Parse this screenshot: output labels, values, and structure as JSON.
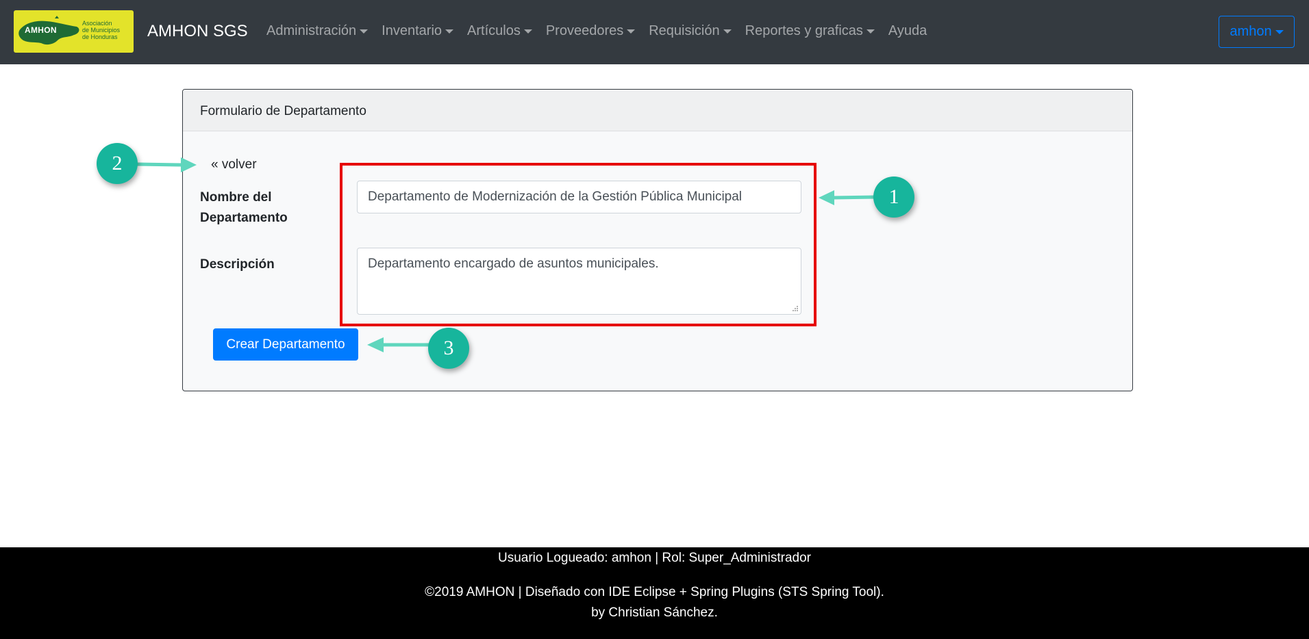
{
  "navbar": {
    "logo_word": "AMHON",
    "logo_text": [
      "Asociación",
      "de Municipios",
      "de Honduras"
    ],
    "brand": "AMHON SGS",
    "items": [
      {
        "label": "Administración",
        "dropdown": true
      },
      {
        "label": "Inventario",
        "dropdown": true
      },
      {
        "label": "Artículos",
        "dropdown": true
      },
      {
        "label": "Proveedores",
        "dropdown": true
      },
      {
        "label": "Requisición",
        "dropdown": true
      },
      {
        "label": "Reportes y graficas",
        "dropdown": true
      },
      {
        "label": "Ayuda",
        "dropdown": false
      }
    ],
    "user": "amhon"
  },
  "form": {
    "title": "Formulario de Departamento",
    "back_link": "« volver",
    "name_label": "Nombre del Departamento",
    "name_value": "Departamento de Modernización de la Gestión Pública Municipal",
    "desc_label": "Descripción",
    "desc_value": "Departamento encargado de asuntos municipales.",
    "submit_label": "Crear Departamento"
  },
  "annotations": {
    "badge_1": "1",
    "badge_2": "2",
    "badge_3": "3",
    "badge_color": "#17b59c",
    "highlight_color": "#e60000"
  },
  "footer": {
    "user_line": "Usuario Logueado: amhon | Rol: Super_Administrador",
    "copyright": "©2019 AMHON | Diseñado con IDE Eclipse + Spring Plugins (STS Spring Tool).",
    "author": "by Christian Sánchez."
  },
  "colors": {
    "navbar_bg": "#343a40",
    "primary": "#007bff",
    "logo_bg": "#e3e32a",
    "footer_bg": "#000000"
  }
}
